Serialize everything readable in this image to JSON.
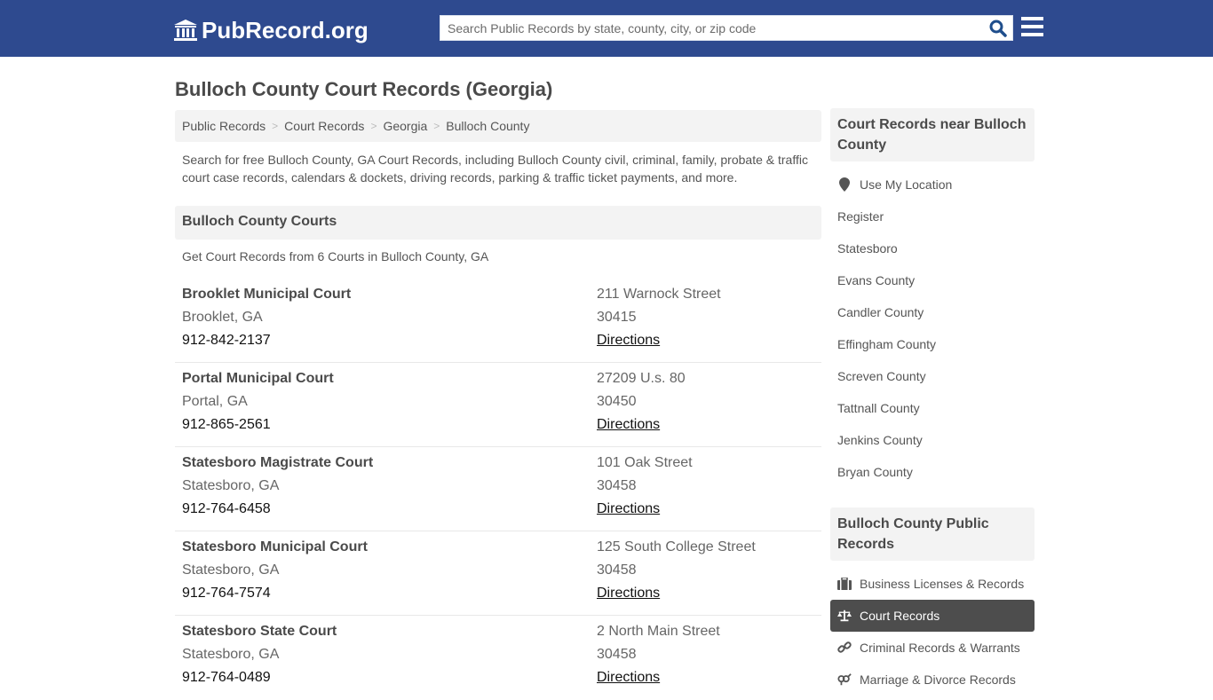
{
  "header": {
    "logo_text": "PubRecord.org",
    "search_placeholder": "Search Public Records by state, county, city, or zip code",
    "search_value": "",
    "brand_color": "#2e4a8f"
  },
  "page": {
    "title": "Bulloch County Court Records (Georgia)",
    "breadcrumb": [
      "Public Records",
      "Court Records",
      "Georgia",
      "Bulloch County"
    ],
    "intro": "Search for free Bulloch County, GA Court Records, including Bulloch County civil, criminal, family, probate & traffic court case records, calendars & dockets, driving records, parking & traffic ticket payments, and more."
  },
  "courts_section": {
    "heading": "Bulloch County Courts",
    "subheading": "Get Court Records from 6 Courts in Bulloch County, GA",
    "directions_label": "Directions",
    "courts": [
      {
        "name": "Brooklet Municipal Court",
        "city": "Brooklet, GA",
        "phone": "912-842-2137",
        "address": "211 Warnock Street",
        "zip": "30415"
      },
      {
        "name": "Portal Municipal Court",
        "city": "Portal, GA",
        "phone": "912-865-2561",
        "address": "27209 U.s. 80",
        "zip": "30450"
      },
      {
        "name": "Statesboro Magistrate Court",
        "city": "Statesboro, GA",
        "phone": "912-764-6458",
        "address": "101 Oak Street",
        "zip": "30458"
      },
      {
        "name": "Statesboro Municipal Court",
        "city": "Statesboro, GA",
        "phone": "912-764-7574",
        "address": "125 South College Street",
        "zip": "30458"
      },
      {
        "name": "Statesboro State Court",
        "city": "Statesboro, GA",
        "phone": "912-764-0489",
        "address": "2 North Main Street",
        "zip": "30458"
      }
    ]
  },
  "sidebar": {
    "nearby_heading": "Court Records near Bulloch County",
    "use_location": "Use My Location",
    "nearby": [
      "Register",
      "Statesboro",
      "Evans County",
      "Candler County",
      "Effingham County",
      "Screven County",
      "Tattnall County",
      "Jenkins County",
      "Bryan County"
    ],
    "public_heading": "Bulloch County Public Records",
    "public_records": [
      {
        "label": "Business Licenses & Records",
        "icon": "briefcase-icon",
        "active": false
      },
      {
        "label": "Court Records",
        "icon": "scale-icon",
        "active": true
      },
      {
        "label": "Criminal Records & Warrants",
        "icon": "link-icon",
        "active": false
      },
      {
        "label": "Marriage & Divorce Records",
        "icon": "venus-mars-icon",
        "active": false
      }
    ]
  }
}
